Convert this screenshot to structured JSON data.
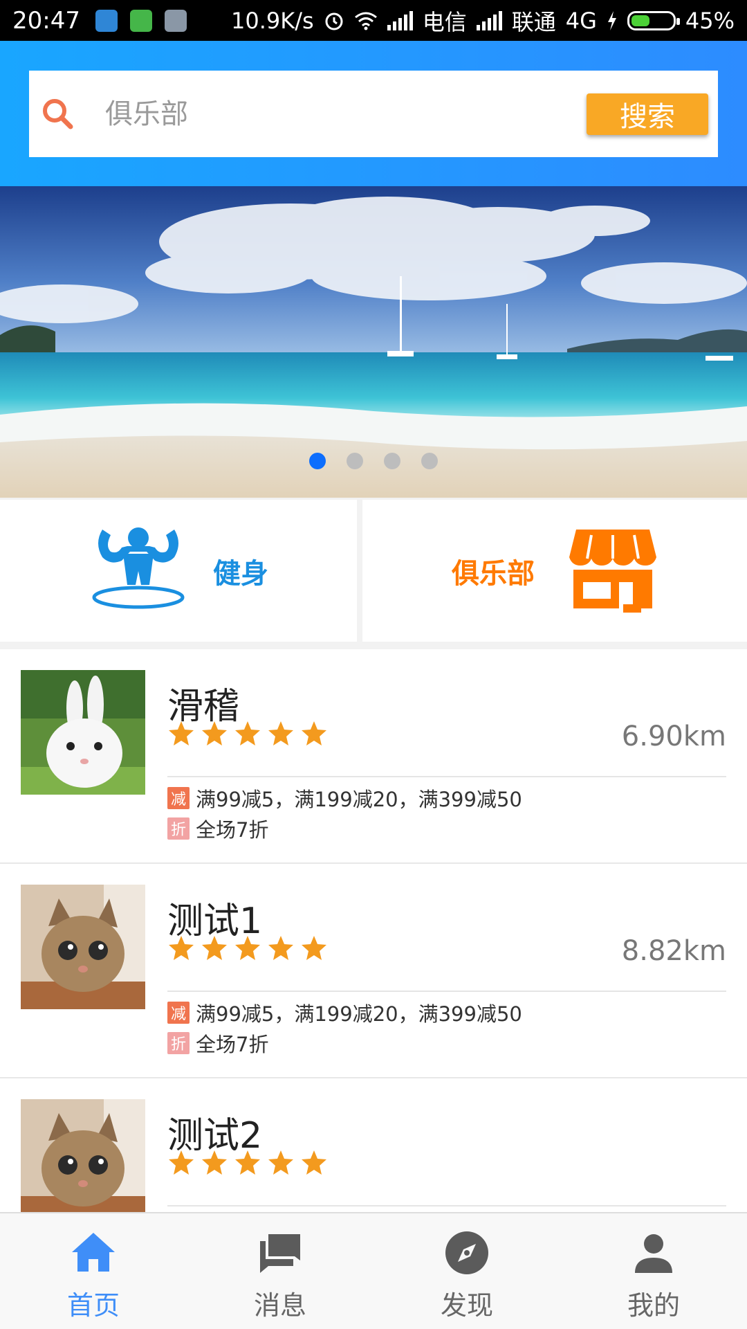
{
  "statusbar": {
    "time": "20:47",
    "speed": "10.9K/s",
    "carrier1": "电信",
    "carrier2": "联通",
    "network": "4G",
    "battery": "45%"
  },
  "search": {
    "placeholder": "俱乐部",
    "button_label": "搜索"
  },
  "banner": {
    "dots": 4,
    "active_index": 0
  },
  "categories": [
    {
      "label": "健身",
      "icon": "fitness-icon",
      "color": "#1a8fe0"
    },
    {
      "label": "俱乐部",
      "icon": "store-icon",
      "color": "#ff7a00"
    }
  ],
  "list": [
    {
      "title": "滑稽",
      "rating": 5,
      "distance": "6.90km",
      "thumb": "rabbit",
      "promos": [
        {
          "tag": "减",
          "text": "满99减5，满199减20，满399减50"
        },
        {
          "tag": "折",
          "text": "全场7折"
        }
      ]
    },
    {
      "title": "测试1",
      "rating": 5,
      "distance": "8.82km",
      "thumb": "cat",
      "promos": [
        {
          "tag": "减",
          "text": "满99减5，满199减20，满399减50"
        },
        {
          "tag": "折",
          "text": "全场7折"
        }
      ]
    },
    {
      "title": "测试2",
      "rating": 5,
      "distance": "",
      "thumb": "cat",
      "promos": []
    }
  ],
  "nav": [
    {
      "label": "首页",
      "icon": "home-icon",
      "active": true
    },
    {
      "label": "消息",
      "icon": "message-icon",
      "active": false
    },
    {
      "label": "发现",
      "icon": "compass-icon",
      "active": false
    },
    {
      "label": "我的",
      "icon": "user-icon",
      "active": false
    }
  ],
  "colors": {
    "header_blue": "#1ea0ff",
    "search_button": "#f9a825",
    "star": "#f39a1e",
    "nav_active": "#3f8ef8"
  }
}
